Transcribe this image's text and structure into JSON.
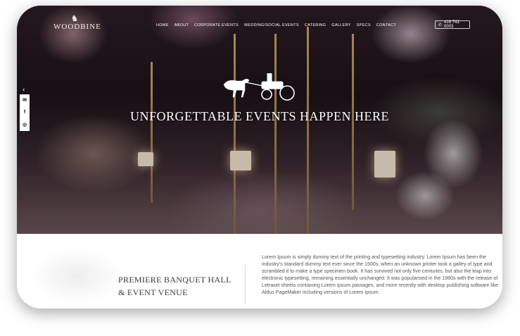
{
  "brand": {
    "name": "WOODBINE"
  },
  "nav": {
    "items": [
      "HOME",
      "ABOUT",
      "CORPORATE EVENTS",
      "WEDDING/SOCIAL EVENTS",
      "CATERING",
      "GALLERY",
      "SPECS",
      "CONTACT"
    ]
  },
  "phone": {
    "number": "416 743 0003"
  },
  "social": {
    "icons": [
      "email-icon",
      "facebook-icon",
      "instagram-icon"
    ]
  },
  "hero": {
    "title": "UNFORGETTABLE EVENTS HAPPEN HERE"
  },
  "venue": {
    "line1": "PREMIERE BANQUET HALL",
    "line2": "&  EVENT VENUE"
  },
  "description": "Lorem Ipsum is simply dummy text of the printing and typesetting industry. Lorem Ipsum has been the industry's standard dummy text ever since the 1500s, when an unknown printer took a galley of type and scrambled it to make a type specimen book. It has survived not only five centuries, but also the leap into electronic typesetting, remaining essentially unchanged. It was popularised in the 1960s with the release of Letraset sheets containing Lorem Ipsum passages, and more recently with desktop publishing software like Aldus PageMaker including versions of Lorem Ipsum.",
  "colors": {
    "accent": "#c9a36a",
    "text_dark": "#3a3a3a",
    "hero_bg": "#1a1216"
  }
}
